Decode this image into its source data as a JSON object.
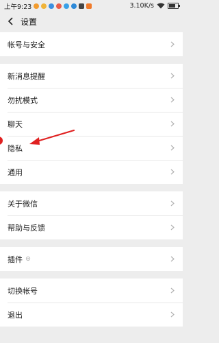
{
  "status_bar": {
    "time": "上午9:23",
    "speed": "3.10K/s",
    "battery": "battery-icon"
  },
  "nav": {
    "title": "设置"
  },
  "groups": [
    {
      "items": [
        {
          "label": "帐号与安全"
        }
      ]
    },
    {
      "items": [
        {
          "label": "新消息提醒"
        },
        {
          "label": "勿扰模式"
        },
        {
          "label": "聊天"
        },
        {
          "label": "隐私"
        },
        {
          "label": "通用"
        }
      ]
    },
    {
      "items": [
        {
          "label": "关于微信"
        },
        {
          "label": "帮助与反馈"
        }
      ]
    },
    {
      "items": [
        {
          "label": "插件",
          "extra_icon": "plugin-icon"
        }
      ]
    },
    {
      "items": [
        {
          "label": "切换帐号"
        },
        {
          "label": "退出"
        }
      ]
    }
  ],
  "colors": {
    "background": "#ededed",
    "annotation": "#e02020"
  }
}
